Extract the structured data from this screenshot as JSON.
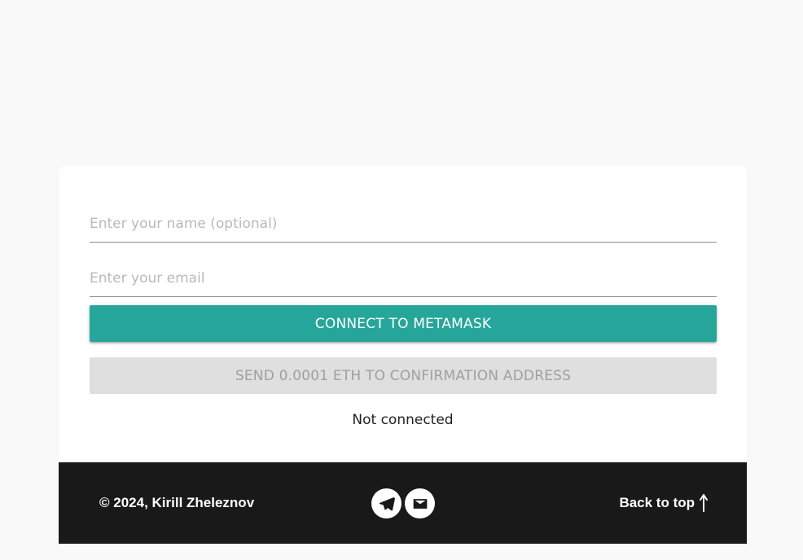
{
  "form": {
    "name_placeholder": "Enter your name (optional)",
    "name_value": "",
    "email_placeholder": "Enter your email",
    "email_value": "",
    "connect_label": "CONNECT TO METAMASK",
    "send_label": "SEND 0.0001 ETH TO CONFIRMATION ADDRESS",
    "status": "Not connected"
  },
  "footer": {
    "copyright": "© 2024, Kirill Zheleznov",
    "social": [
      {
        "icon": "telegram-icon"
      },
      {
        "icon": "mail-icon"
      }
    ],
    "back_to_top": "Back to top",
    "back_to_top_icon": "arrow-up-icon"
  },
  "colors": {
    "page_background": "#f9f9f9",
    "card_background": "#ffffff",
    "accent": "#26a69a",
    "disabled_button": "#dfdfdf",
    "disabled_text": "#9f9f9f",
    "footer_background": "#191919"
  }
}
